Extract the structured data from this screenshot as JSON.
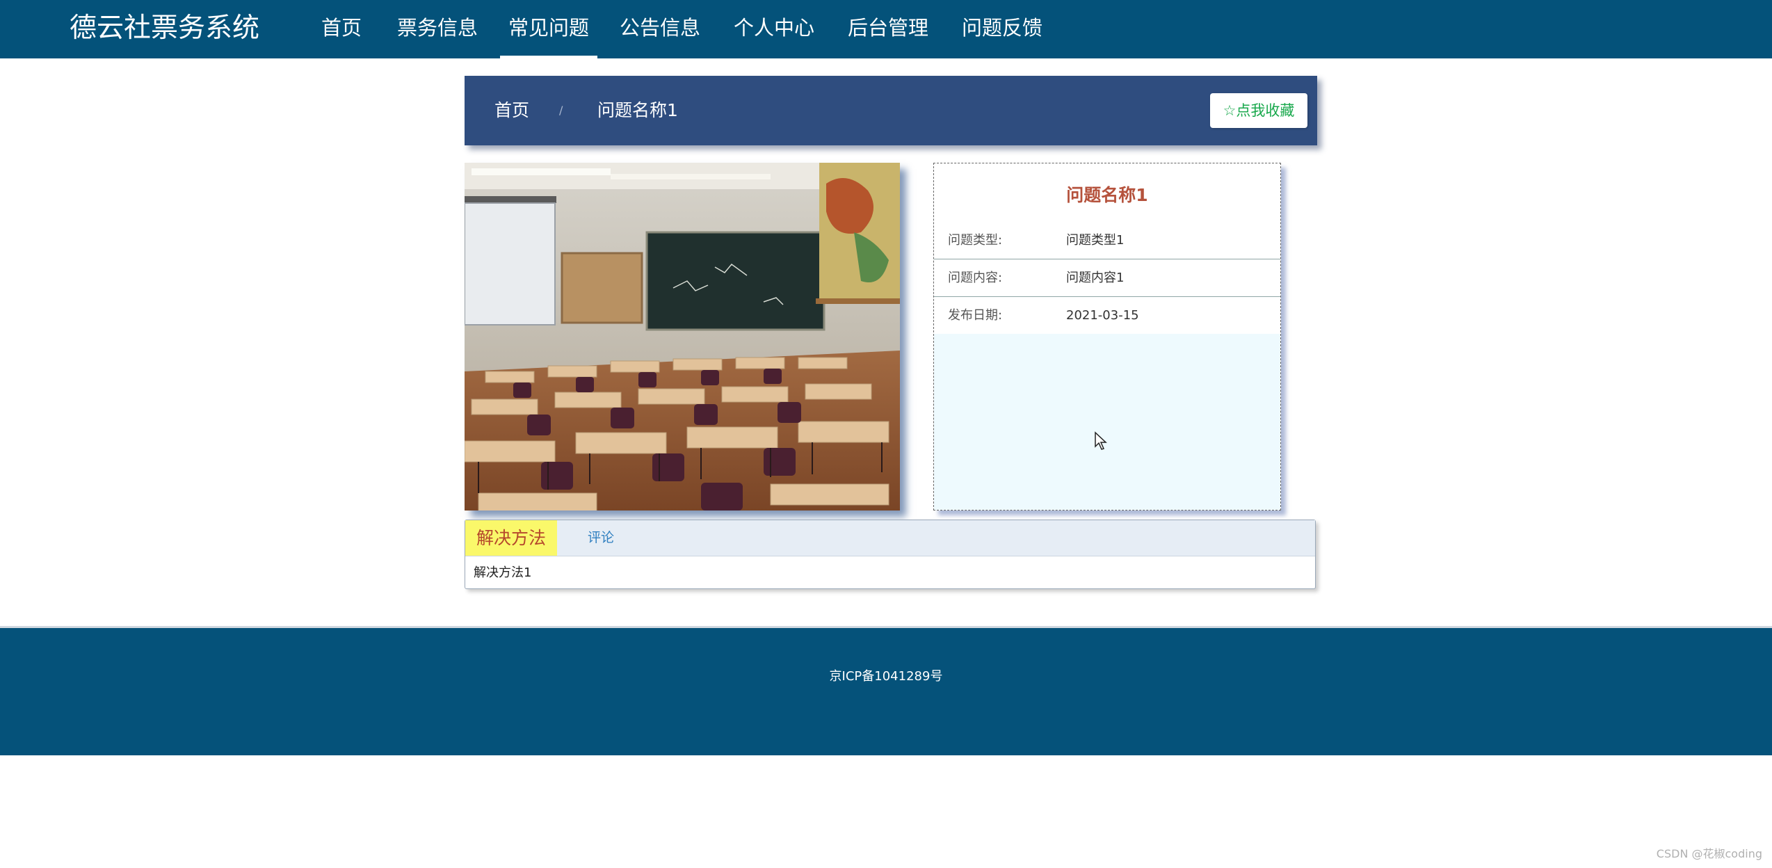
{
  "header": {
    "brand": "德云社票务系统",
    "nav": [
      {
        "label": "首页"
      },
      {
        "label": "票务信息"
      },
      {
        "label": "常见问题",
        "active": true
      },
      {
        "label": "公告信息"
      },
      {
        "label": "个人中心"
      },
      {
        "label": "后台管理"
      },
      {
        "label": "问题反馈"
      }
    ]
  },
  "breadcrumb": {
    "home": "首页",
    "separator": "/",
    "current": "问题名称1",
    "favorite_label": "点我收藏",
    "favorite_icon": "star-outline-icon"
  },
  "detail": {
    "title": "问题名称1",
    "rows": [
      {
        "label": "问题类型:",
        "value": "问题类型1"
      },
      {
        "label": "问题内容:",
        "value": "问题内容1"
      },
      {
        "label": "发布日期:",
        "value": "2021-03-15"
      }
    ]
  },
  "tabs": {
    "items": [
      {
        "label": "解决方法",
        "active": true
      },
      {
        "label": "评论"
      }
    ],
    "content": "解决方法1"
  },
  "footer": {
    "icp": "京ICP备1041289号"
  },
  "watermark": "CSDN @花椒coding",
  "colors": {
    "nav_bg": "#04527a",
    "breadcrumb_bg": "#2f4d7f",
    "favorite_text": "#18a84c",
    "detail_title": "#b5523c",
    "tab_active_bg": "#faf86a"
  }
}
